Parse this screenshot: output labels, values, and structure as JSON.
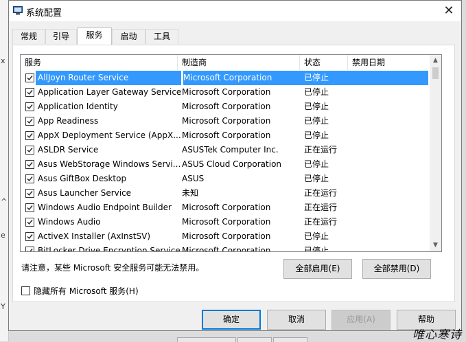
{
  "window": {
    "title": "系统配置"
  },
  "tabs": [
    {
      "label": "常规"
    },
    {
      "label": "引导"
    },
    {
      "label": "服务"
    },
    {
      "label": "启动"
    },
    {
      "label": "工具"
    }
  ],
  "active_tab": "服务",
  "table": {
    "columns": [
      "服务",
      "制造商",
      "状态",
      "禁用日期"
    ],
    "rows": [
      {
        "name": "AllJoyn Router Service",
        "vendor": "Microsoft Corporation",
        "status": "已停止",
        "date": "",
        "checked": true,
        "selected": true
      },
      {
        "name": "Application Layer Gateway Service",
        "vendor": "Microsoft Corporation",
        "status": "已停止",
        "date": "",
        "checked": true
      },
      {
        "name": "Application Identity",
        "vendor": "Microsoft Corporation",
        "status": "已停止",
        "date": "",
        "checked": true
      },
      {
        "name": "App Readiness",
        "vendor": "Microsoft Corporation",
        "status": "已停止",
        "date": "",
        "checked": true
      },
      {
        "name": "AppX Deployment Service (AppX...",
        "vendor": "Microsoft Corporation",
        "status": "已停止",
        "date": "",
        "checked": true
      },
      {
        "name": "ASLDR Service",
        "vendor": "ASUSTek Computer Inc.",
        "status": "正在运行",
        "date": "",
        "checked": true
      },
      {
        "name": "Asus WebStorage Windows Servi...",
        "vendor": "ASUS Cloud Corporation",
        "status": "已停止",
        "date": "",
        "checked": true
      },
      {
        "name": "Asus GiftBox Desktop",
        "vendor": "ASUS",
        "status": "已停止",
        "date": "",
        "checked": true
      },
      {
        "name": "Asus Launcher Service",
        "vendor": "未知",
        "status": "正在运行",
        "date": "",
        "checked": true
      },
      {
        "name": "Windows Audio Endpoint Builder",
        "vendor": "Microsoft Corporation",
        "status": "正在运行",
        "date": "",
        "checked": true
      },
      {
        "name": "Windows Audio",
        "vendor": "Microsoft Corporation",
        "status": "正在运行",
        "date": "",
        "checked": true
      },
      {
        "name": "ActiveX Installer (AxInstSV)",
        "vendor": "Microsoft Corporation",
        "status": "已停止",
        "date": "",
        "checked": true
      },
      {
        "name": "BitLocker Drive Encryption Service",
        "vendor": "Microsoft Corporation",
        "status": "已停止",
        "date": "",
        "checked": true
      }
    ]
  },
  "note": "请注意，某些 Microsoft 安全服务可能无法禁用。",
  "buttons": {
    "enable_all": "全部启用(E)",
    "disable_all": "全部禁用(D)",
    "ok": "确定",
    "cancel": "取消",
    "apply": "应用(A)",
    "help": "帮助"
  },
  "hide_ms": {
    "label": "隐藏所有 Microsoft 服务(H)",
    "checked": false
  },
  "background": {
    "left_glyphs": [
      "x",
      "^",
      "e",
      "Y"
    ]
  },
  "watermark": "唯心寒诗",
  "colors": {
    "selection": "#3399ff",
    "focus_border": "#0078d7"
  }
}
